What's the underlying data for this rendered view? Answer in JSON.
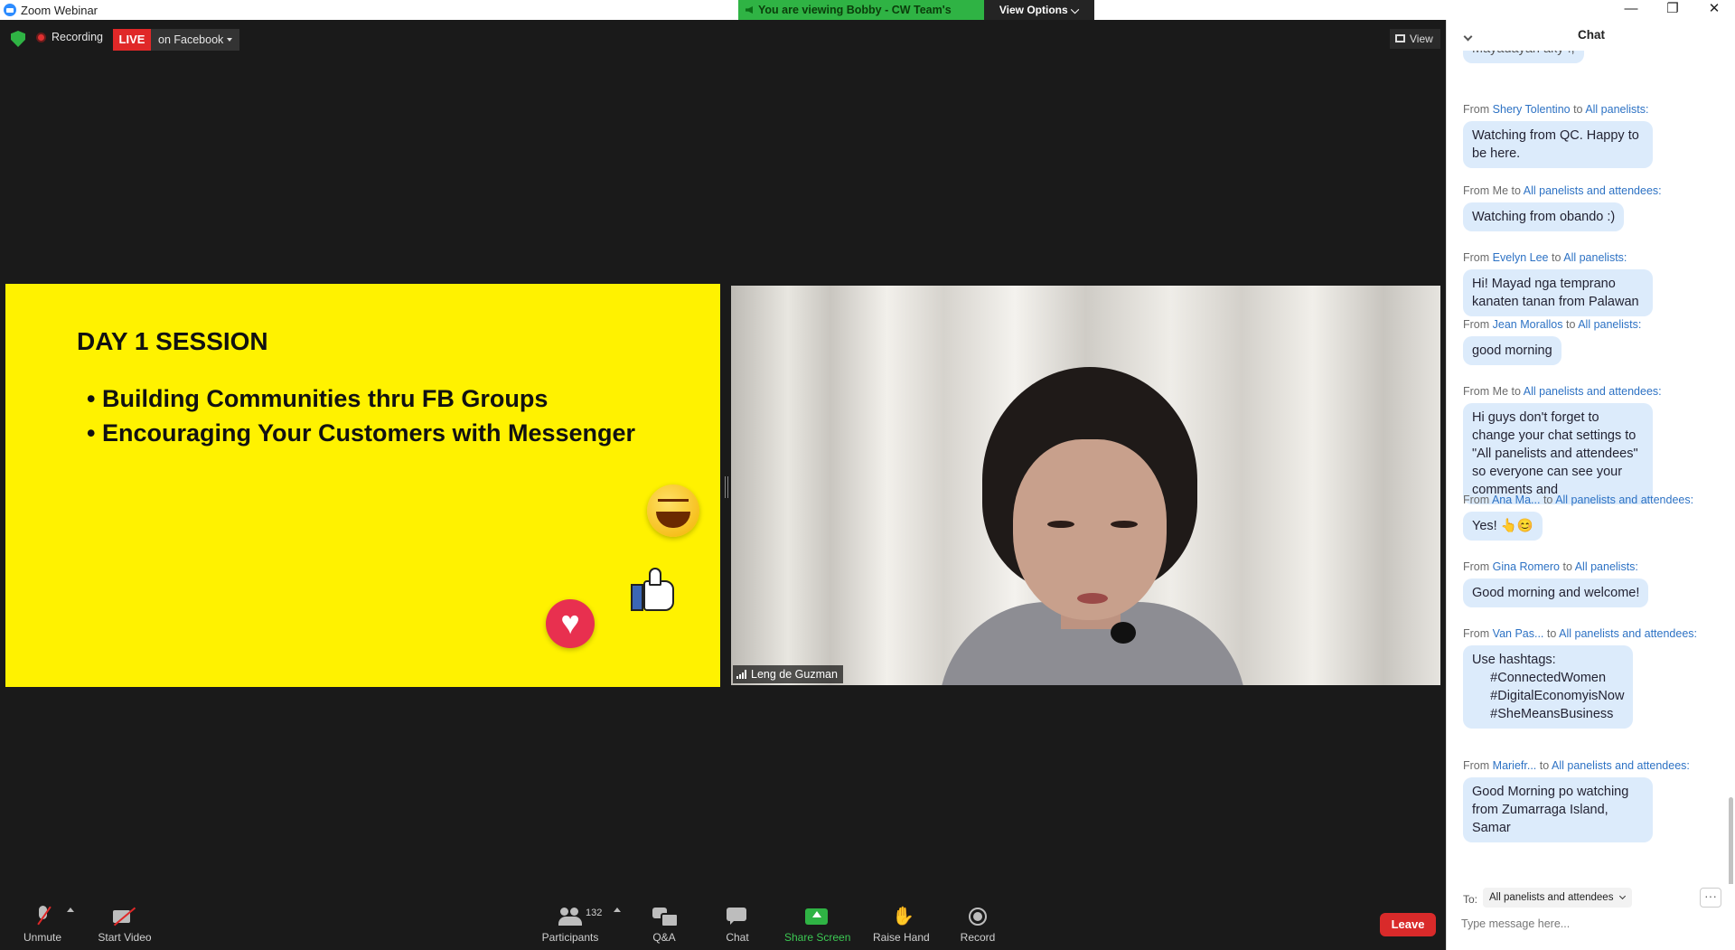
{
  "window": {
    "title": "Zoom Webinar",
    "minimize": "—",
    "restore": "❐",
    "close": "✕"
  },
  "banner": {
    "viewing_text": "You are viewing Bobby - CW Team's screen",
    "view_options": "View Options ⌵"
  },
  "top_controls": {
    "recording": "Recording",
    "live_badge": "LIVE",
    "live_target": "on Facebook",
    "view": "View"
  },
  "slide": {
    "title": "DAY 1 SESSION",
    "bullets": [
      "• Building Communities thru FB Groups",
      "• Encouraging Your Customers with Messenger"
    ]
  },
  "video": {
    "participant_name": "Leng de Guzman"
  },
  "toolbar": {
    "unmute": "Unmute",
    "start_video": "Start Video",
    "participants": "Participants",
    "participant_count": "132",
    "qa": "Q&A",
    "chat": "Chat",
    "share_screen": "Share Screen",
    "raise_hand": "Raise Hand",
    "record": "Record",
    "leave": "Leave"
  },
  "chat": {
    "title": "Chat",
    "partial_text": "Mayadayan aky !,",
    "messages": [
      {
        "from": "Shery Tolentino",
        "to": "All panelists:",
        "text": "Watching from QC. Happy to be here."
      },
      {
        "from": "Me",
        "to": "All panelists and attendees:",
        "text": "Watching from obando :)"
      },
      {
        "from": "Evelyn Lee",
        "to": "All panelists:",
        "text": "Hi! Mayad nga temprano kanaten tanan from Palawan"
      },
      {
        "from": "Jean Morallos",
        "to": "All panelists:",
        "text": "good morning"
      },
      {
        "from": "Me",
        "to": "All panelists and attendees:",
        "text": "Hi guys don't forget to change your chat settings to \"All panelists and attendees\" so everyone can see your comments and"
      },
      {
        "from": "Ana Ma...",
        "to": "All panelists and attendees:",
        "text": "Yes! 👆😊"
      },
      {
        "from": "Gina Romero",
        "to": "All panelists:",
        "text": "Good morning and welcome!"
      },
      {
        "from": "Van Pas...",
        "to": "All panelists and attendees:",
        "text": "Use hashtags:\n     #ConnectedWomen\n     #DigitalEconomyisNow\n     #SheMeansBusiness"
      },
      {
        "from": "Mariefr...",
        "to": "All panelists and attendees:",
        "text": "Good Morning po watching from Zumarraga Island, Samar"
      }
    ],
    "from_word": "From",
    "to_word": "to",
    "to_label": "To:",
    "to_value": "All panelists and attendees",
    "more": "···",
    "input_placeholder": "Type message here..."
  }
}
